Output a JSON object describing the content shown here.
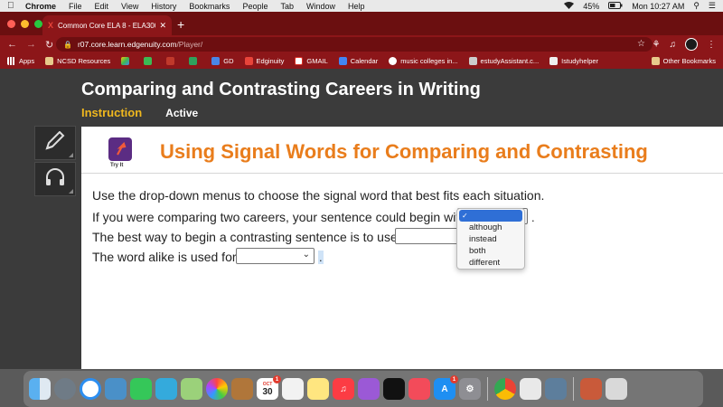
{
  "menubar": {
    "items": [
      "Chrome",
      "File",
      "Edit",
      "View",
      "History",
      "Bookmarks",
      "People",
      "Tab",
      "Window",
      "Help"
    ],
    "battery": "45%",
    "clock": "Mon 10:27 AM"
  },
  "browser": {
    "tab_title": "Common Core ELA 8 - ELA300",
    "url_host": "r07.core.learn.edgenuity.com",
    "url_path": "/Player/",
    "bookmarks": [
      "Apps",
      "NCSD Resources",
      "GD",
      "Edginuity",
      "GMAIL",
      "Calendar",
      "music colleges in...",
      "estudyAssistant.c...",
      "Istudyhelper"
    ],
    "other_bookmarks": "Other Bookmarks"
  },
  "page": {
    "course_title": "Comparing and Contrasting Careers in Writing",
    "tab_instruction": "Instruction",
    "tab_active": "Active",
    "tryit_label": "Try It",
    "banner": "Using Signal Words for Comparing and Contrasting",
    "directions": "Use the drop-down menus to choose the signal word that best fits each situation.",
    "q1": "If you were comparing two careers, your sentence could begin with",
    "q2": "The best way to begin a contrasting sentence is to use",
    "q3": "The word alike is used for",
    "period": "."
  },
  "dropdown": {
    "options": [
      "although",
      "instead",
      "both",
      "different"
    ]
  },
  "dock": {
    "calendar_month": "OCT",
    "calendar_day": "30",
    "badge_calendar": "1",
    "badge_appstore": "1"
  },
  "colors": {
    "chrome_red": "#8c1619",
    "banner_orange": "#e97d1c",
    "instruction_gold": "#f0b81e",
    "select_blue": "#2f6fd6"
  }
}
